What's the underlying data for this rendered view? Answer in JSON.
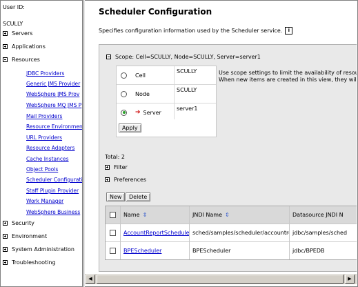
{
  "nav": {
    "user_label": "User ID:",
    "host": "SCULLY",
    "top_items": [
      {
        "label": "Servers",
        "expanded": false
      },
      {
        "label": "Applications",
        "expanded": false
      },
      {
        "label": "Resources",
        "expanded": true
      }
    ],
    "resources": [
      "JDBC Providers",
      "Generic JMS Provider",
      "WebSphere JMS Prov",
      "WebSphere MQ JMS P",
      "Mail Providers",
      "Resource Environmen",
      "URL Providers",
      "Resource Adapters",
      "Cache Instances",
      "Object Pools",
      "Scheduler Configuratio",
      "Staff Plugin Provider",
      "Work Manager",
      "WebSphere Business"
    ],
    "bottom_items": [
      {
        "label": "Security",
        "expanded": false
      },
      {
        "label": "Environment",
        "expanded": false
      },
      {
        "label": "System Administration",
        "expanded": false
      },
      {
        "label": "Troubleshooting",
        "expanded": false
      }
    ]
  },
  "main": {
    "title": "Scheduler Configuration",
    "description": "Specifies configuration information used by the Scheduler service.",
    "info_icon": "i",
    "scope": {
      "header": "Scope: Cell=SCULLY, Node=SCULLY, Server=server1",
      "rows": [
        {
          "label": "Cell",
          "value": "SCULLY",
          "selected": false
        },
        {
          "label": "Node",
          "value": "SCULLY",
          "selected": false
        },
        {
          "label": "Server",
          "value": "server1",
          "selected": true
        }
      ],
      "apply_label": "Apply",
      "help_line1": "Use scope settings to limit the availability of resour",
      "help_line2": "When new items are created in this view, they will b"
    },
    "total": "Total: 2",
    "filter_label": "Filter",
    "preferences_label": "Preferences",
    "new_label": "New",
    "delete_label": "Delete",
    "table": {
      "headers": [
        "Name",
        "JNDI Name",
        "Datasource JNDI N"
      ],
      "rows": [
        {
          "name": "AccountReportScheduler",
          "jndi": "sched/samples/scheduler/accountreport",
          "ds": "jdbc/samples/sched"
        },
        {
          "name": "BPEScheduler",
          "jndi": "BPEScheduler",
          "ds": "jdbc/BPEDB"
        }
      ]
    }
  },
  "colors": {
    "link": "#0000cc",
    "panel_bg": "#e9e9e9",
    "header_bg": "#d9d9d9",
    "selected_radio": "#2aa22a",
    "arrow": "#cc0000"
  }
}
